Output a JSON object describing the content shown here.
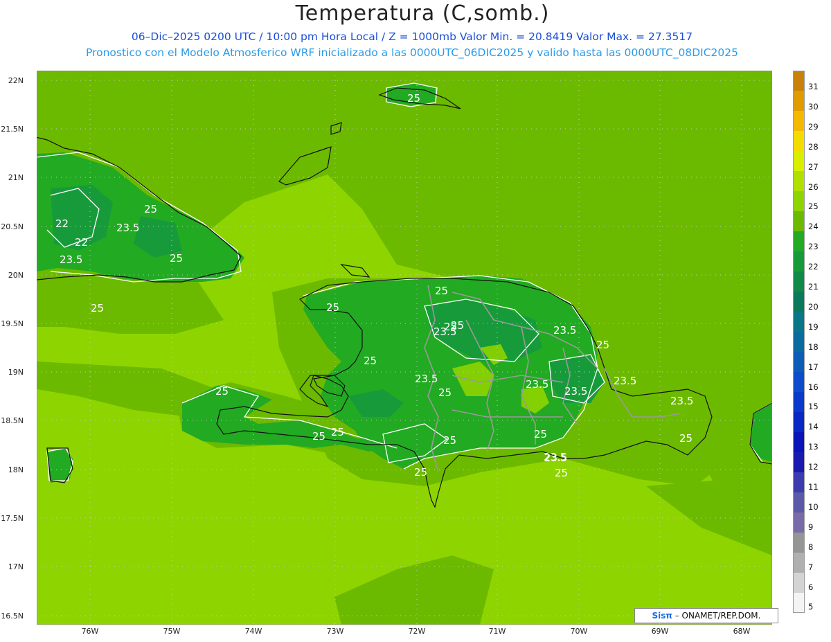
{
  "header": {
    "title": "Temperatura (C,somb.)",
    "line1": "06–Dic–2025 0200 UTC / 10:00 pm Hora Local / Z = 1000mb   Valor Min. = 20.8419   Valor Max. = 27.3517",
    "line2": "Pronostico con el Modelo Atmosferico WRF inicializado a las 0000UTC_06DIC2025 y valido hasta las  0000UTC_08DIC2025"
  },
  "lat_labels": [
    "22N",
    "21.5N",
    "21N",
    "20.5N",
    "20N",
    "19.5N",
    "19N",
    "18.5N",
    "18N",
    "17.5N",
    "17N",
    "16.5N"
  ],
  "lon_labels": [
    "76W",
    "75W",
    "74W",
    "73W",
    "72W",
    "71W",
    "70W",
    "69W",
    "68W"
  ],
  "contour_labels": [
    "25",
    "22",
    "23.5",
    "22",
    "23.5",
    "25",
    "25",
    "25",
    "25",
    "25",
    "23.5",
    "25",
    "23.5",
    "23.5",
    "25",
    "23.5",
    "25",
    "25",
    "25",
    "23.5",
    "25",
    "23.5",
    "25",
    "23.5",
    "25",
    "23.5",
    "25",
    "25",
    "25",
    "23.5",
    "25",
    "25"
  ],
  "colorbar": {
    "labels": [
      "31",
      "30",
      "29",
      "28",
      "27",
      "26",
      "25",
      "24",
      "23",
      "22",
      "21",
      "20",
      "19",
      "18",
      "17",
      "16",
      "15",
      "14",
      "13",
      "12",
      "11",
      "10",
      "9",
      "8",
      "7",
      "6",
      "5"
    ],
    "colors": [
      "#c8820a",
      "#e09b00",
      "#f5b800",
      "#f5dc00",
      "#d8f000",
      "#b0e000",
      "#8ed400",
      "#6cba00",
      "#22aa22",
      "#179b3a",
      "#0f8a48",
      "#0a7a5a",
      "#0a7788",
      "#0b6ba0",
      "#0d5cb8",
      "#0d4ccc",
      "#0a3acc",
      "#0a28c4",
      "#0a14b8",
      "#1a1ab0",
      "#3c3cae",
      "#5a5aa8",
      "#7a6aa8",
      "#959595",
      "#b0b0b0",
      "#d4d4d4",
      "#f4f4f4"
    ]
  },
  "credit": {
    "logo": "Sisπ",
    "text": " – ONAMET/REP.DOM."
  }
}
